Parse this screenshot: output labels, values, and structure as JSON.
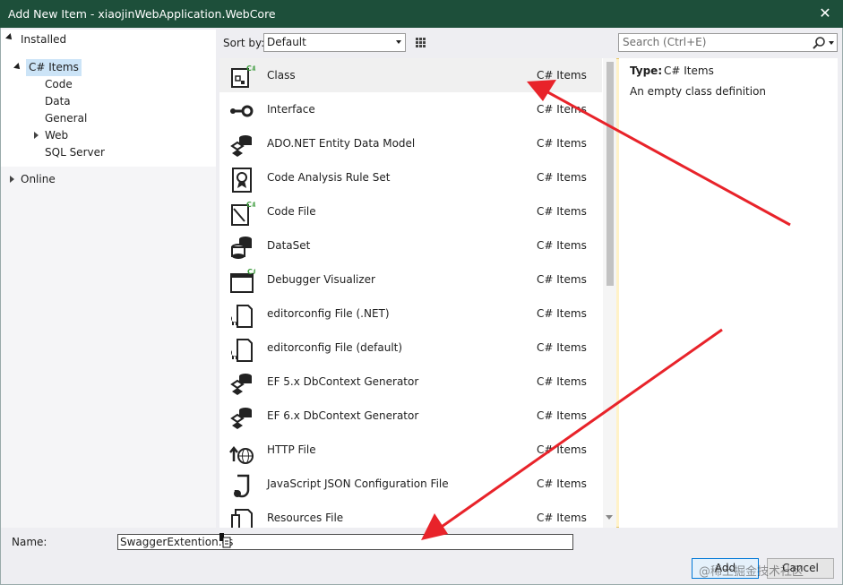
{
  "window": {
    "title": "Add New Item - xiaojinWebApplication.WebCore"
  },
  "tree": {
    "installed": "Installed",
    "csharp_items": "C# Items",
    "children": [
      "Code",
      "Data",
      "General",
      "Web",
      "SQL Server"
    ],
    "online": "Online"
  },
  "toolbar": {
    "sort_label": "Sort by:",
    "sort_value": "Default",
    "search_placeholder": "Search (Ctrl+E)"
  },
  "items": [
    {
      "name": "Class",
      "category": "C# Items",
      "icon": "class-icon"
    },
    {
      "name": "Interface",
      "category": "C# Items",
      "icon": "interface-icon"
    },
    {
      "name": "ADO.NET Entity Data Model",
      "category": "C# Items",
      "icon": "entity-model-icon"
    },
    {
      "name": "Code Analysis Rule Set",
      "category": "C# Items",
      "icon": "rule-set-icon"
    },
    {
      "name": "Code File",
      "category": "C# Items",
      "icon": "code-file-icon"
    },
    {
      "name": "DataSet",
      "category": "C# Items",
      "icon": "dataset-icon"
    },
    {
      "name": "Debugger Visualizer",
      "category": "C# Items",
      "icon": "debugger-visualizer-icon"
    },
    {
      "name": "editorconfig File (.NET)",
      "category": "C# Items",
      "icon": "editorconfig-icon"
    },
    {
      "name": "editorconfig File (default)",
      "category": "C# Items",
      "icon": "editorconfig-icon"
    },
    {
      "name": "EF 5.x DbContext Generator",
      "category": "C# Items",
      "icon": "ef-generator-icon"
    },
    {
      "name": "EF 6.x DbContext Generator",
      "category": "C# Items",
      "icon": "ef-generator-icon"
    },
    {
      "name": "HTTP File",
      "category": "C# Items",
      "icon": "http-file-icon"
    },
    {
      "name": "JavaScript JSON Configuration File",
      "category": "C# Items",
      "icon": "json-config-icon"
    },
    {
      "name": "Resources File",
      "category": "C# Items",
      "icon": "resources-file-icon"
    }
  ],
  "info": {
    "type_label": "Type:",
    "type_value": "C# Items",
    "description": "An empty class definition"
  },
  "footer": {
    "name_label": "Name:",
    "name_value": "SwaggerExtention.cs",
    "add_label": "Add",
    "cancel_label": "Cancel"
  },
  "watermark": "@稀土掘金技术社区",
  "colors": {
    "titlebar": "#1d4f3a",
    "selection": "#cce4f7",
    "annotation_arrow": "#e8232a"
  }
}
